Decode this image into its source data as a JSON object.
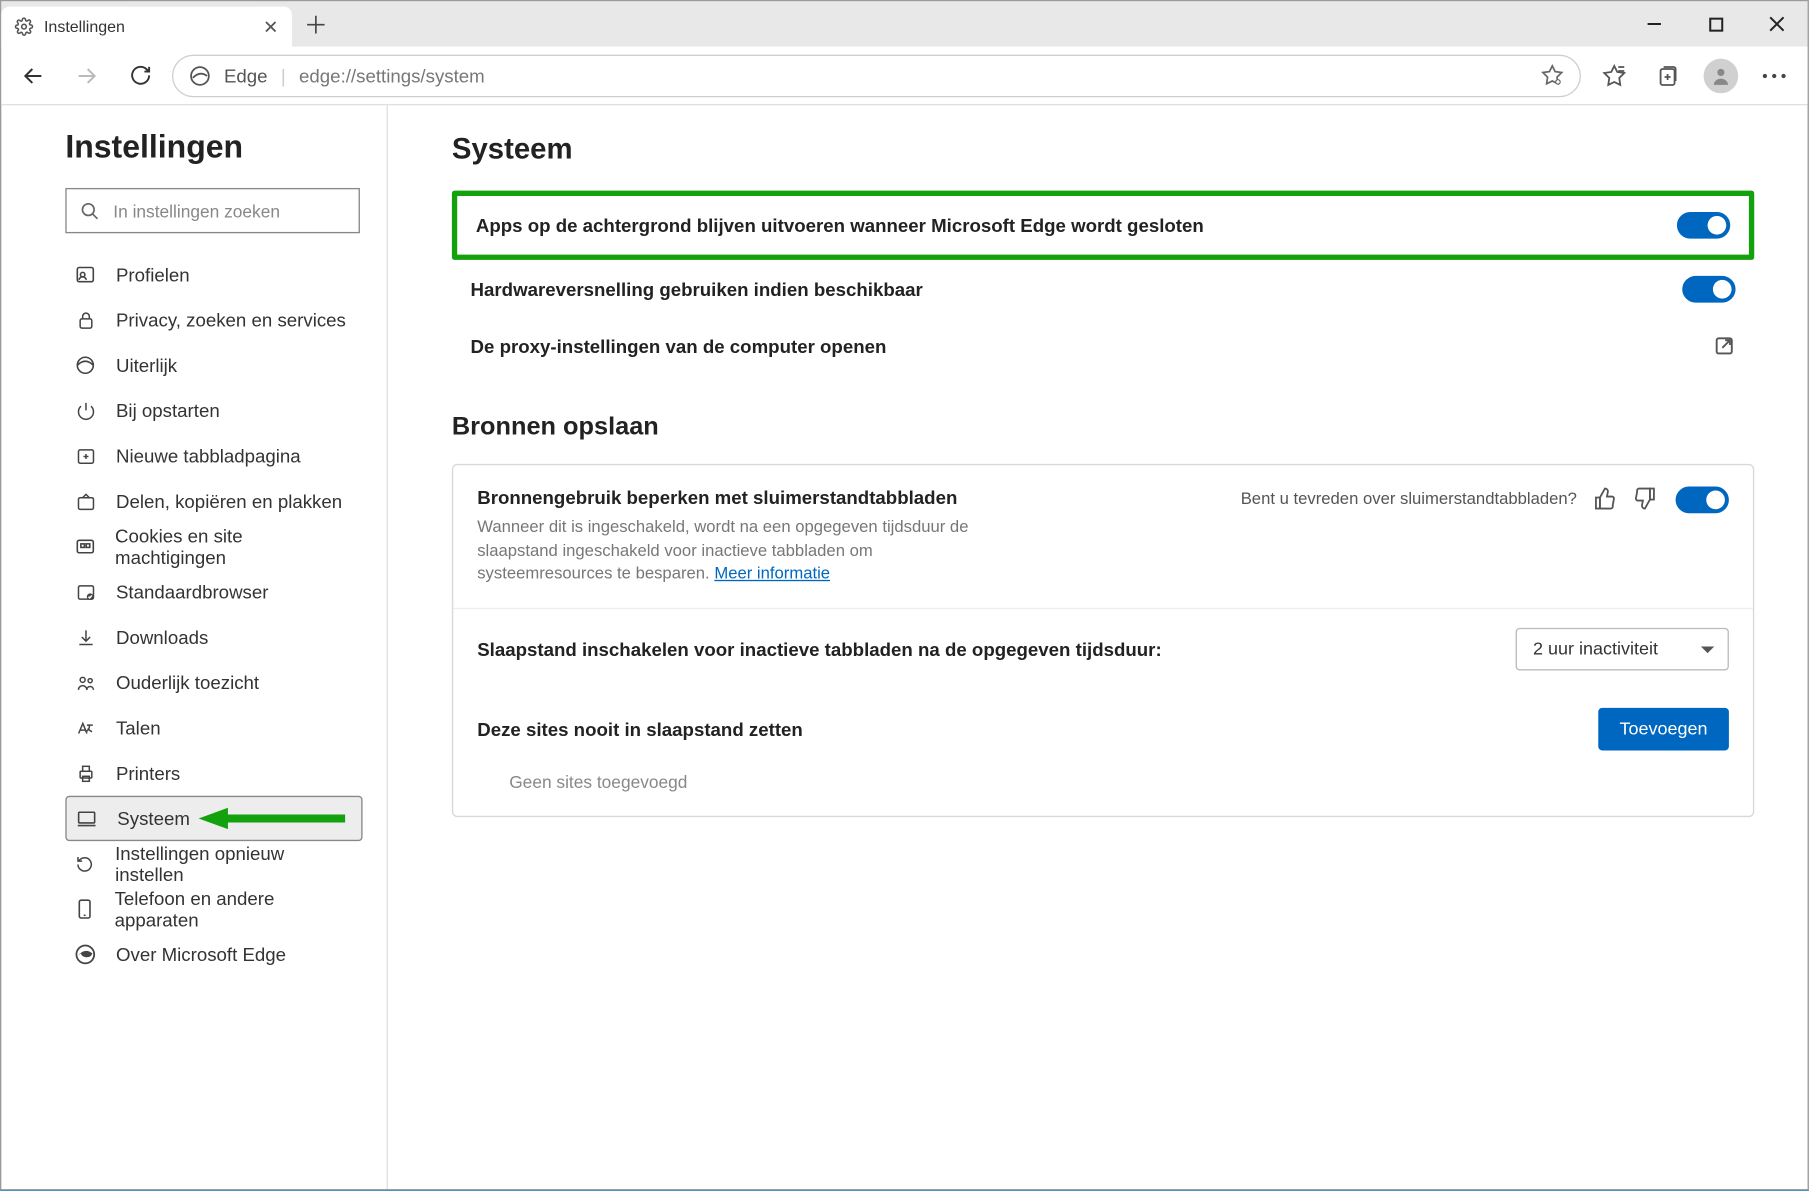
{
  "tab": {
    "title": "Instellingen"
  },
  "toolbar": {
    "scheme_label": "Edge",
    "url": "edge://settings/system"
  },
  "sidebar": {
    "title": "Instellingen",
    "search_placeholder": "In instellingen zoeken",
    "items": [
      {
        "label": "Profielen"
      },
      {
        "label": "Privacy, zoeken en services"
      },
      {
        "label": "Uiterlijk"
      },
      {
        "label": "Bij opstarten"
      },
      {
        "label": "Nieuwe tabbladpagina"
      },
      {
        "label": "Delen, kopiëren en plakken"
      },
      {
        "label": "Cookies en site machtigingen"
      },
      {
        "label": "Standaardbrowser"
      },
      {
        "label": "Downloads"
      },
      {
        "label": "Ouderlijk toezicht"
      },
      {
        "label": "Talen"
      },
      {
        "label": "Printers"
      },
      {
        "label": "Systeem"
      },
      {
        "label": "Instellingen opnieuw instellen"
      },
      {
        "label": "Telefoon en andere apparaten"
      },
      {
        "label": "Over Microsoft Edge"
      }
    ]
  },
  "main": {
    "heading": "Systeem",
    "rows": [
      {
        "label": "Apps op de achtergrond blijven uitvoeren wanneer Microsoft Edge wordt gesloten"
      },
      {
        "label": "Hardwareversnelling gebruiken indien beschikbaar"
      },
      {
        "label": "De proxy-instellingen van de computer openen"
      }
    ],
    "section2": "Bronnen opslaan",
    "card": {
      "title": "Bronnengebruik beperken met sluimerstandtabbladen",
      "desc": "Wanneer dit is ingeschakeld, wordt na een opgegeven tijdsduur de slaapstand ingeschakeld voor inactieve tabbladen om systeemresources te besparen. ",
      "learn_more": "Meer informatie",
      "feedback_q": "Bent u tevreden over sluimerstandtabbladen?",
      "sleep_label": "Slaapstand inschakelen voor inactieve tabbladen na de opgegeven tijdsduur:",
      "sleep_value": "2 uur inactiviteit",
      "never_label": "Deze sites nooit in slaapstand zetten",
      "add_button": "Toevoegen",
      "empty": "Geen sites toegevoegd"
    }
  }
}
